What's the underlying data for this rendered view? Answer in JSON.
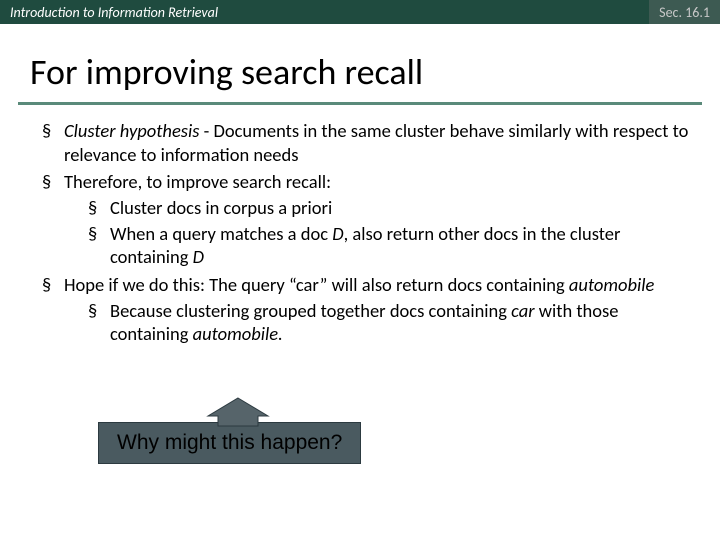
{
  "topbar": {
    "left": "Introduction to Information Retrieval",
    "right": "Sec. 16.1"
  },
  "title": "For improving search recall",
  "bullets": {
    "b1_prefix_italic": "Cluster hypothesis",
    "b1_rest": " - Documents in the same cluster behave similarly with respect to relevance to information needs",
    "b2": "Therefore, to improve search recall:",
    "b2_sub1": "Cluster docs in corpus a priori",
    "b2_sub2_a": "When a query matches a doc ",
    "b2_sub2_D": "D",
    "b2_sub2_b": ", also return other docs in the cluster containing ",
    "b2_sub2_D2": "D",
    "b3_a": "Hope if we do this: The query “car” will also return docs containing ",
    "b3_auto": "automobile",
    "b3_sub_a": "Because clustering grouped together docs containing ",
    "b3_sub_car": "car",
    "b3_sub_b": " with those containing ",
    "b3_sub_auto": "automobile.",
    "callout": "Why might this happen?"
  }
}
